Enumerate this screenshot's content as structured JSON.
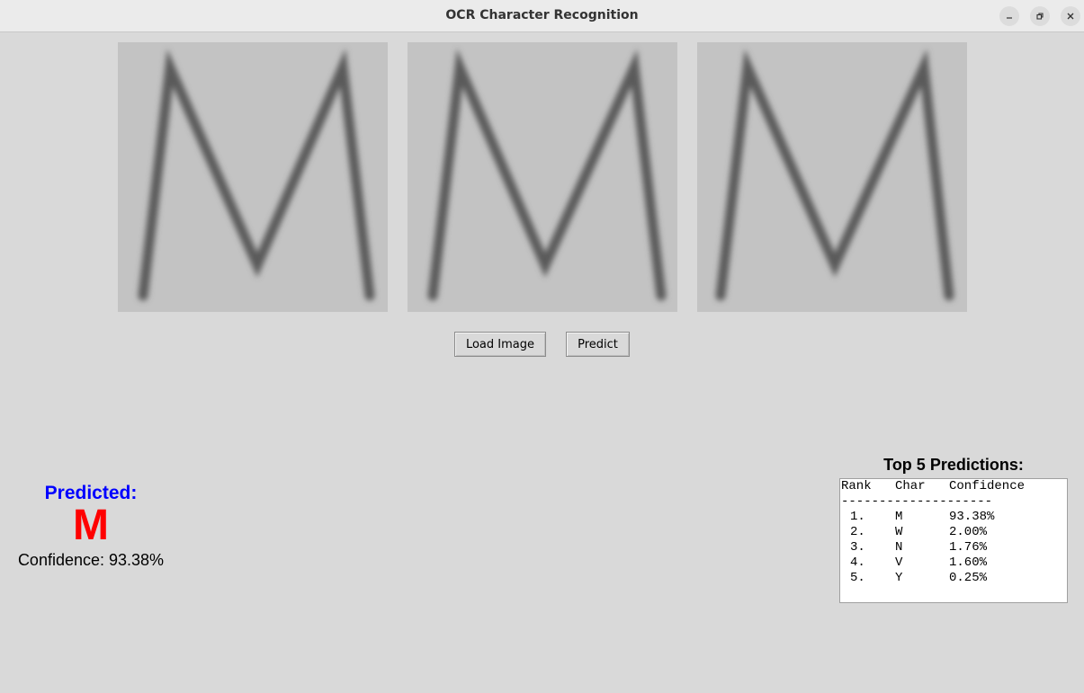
{
  "window": {
    "title": "OCR Character Recognition",
    "controls": [
      "minimize-icon",
      "restore-icon",
      "close-icon"
    ]
  },
  "images": [
    {
      "name": "character-image-1",
      "letter": "M"
    },
    {
      "name": "character-image-2",
      "letter": "M"
    },
    {
      "name": "character-image-3",
      "letter": "M"
    }
  ],
  "buttons": {
    "load": "Load Image",
    "predict": "Predict"
  },
  "prediction": {
    "label": "Predicted:",
    "character": "M",
    "confidence_text": "Confidence: 93.38%",
    "colors": {
      "label": "#0000ff",
      "character": "#ff0000"
    }
  },
  "top5": {
    "title": "Top 5 Predictions:",
    "headers": [
      "Rank",
      "Char",
      "Confidence"
    ],
    "separator": "--------------------",
    "rows": [
      {
        "rank": "1.",
        "char": "M",
        "confidence": "93.38%"
      },
      {
        "rank": "2.",
        "char": "W",
        "confidence": "2.00%"
      },
      {
        "rank": "3.",
        "char": "N",
        "confidence": "1.76%"
      },
      {
        "rank": "4.",
        "char": "V",
        "confidence": "1.60%"
      },
      {
        "rank": "5.",
        "char": "Y",
        "confidence": "0.25%"
      }
    ]
  }
}
